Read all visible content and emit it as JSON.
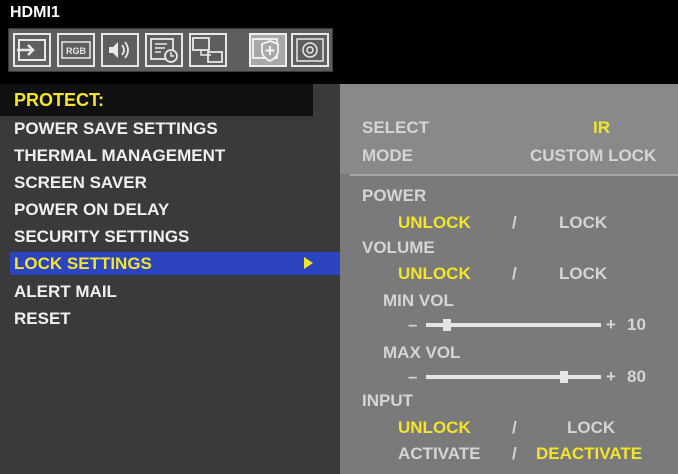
{
  "header": {
    "input_name": "HDMI1"
  },
  "icon_tabs": [
    {
      "name": "input-icon"
    },
    {
      "name": "rgb-icon",
      "label": "RGB"
    },
    {
      "name": "audio-icon"
    },
    {
      "name": "schedule-icon"
    },
    {
      "name": "multi-display-icon"
    },
    {
      "name": "protect-icon",
      "selected": true
    },
    {
      "name": "system-icon"
    }
  ],
  "menu": {
    "title": "PROTECT:",
    "items": [
      {
        "label": "POWER SAVE SETTINGS"
      },
      {
        "label": "THERMAL MANAGEMENT"
      },
      {
        "label": "SCREEN SAVER"
      },
      {
        "label": "POWER ON DELAY"
      },
      {
        "label": "SECURITY SETTINGS"
      },
      {
        "label": "LOCK SETTINGS",
        "selected": true
      },
      {
        "label": "ALERT MAIL"
      },
      {
        "label": "RESET"
      }
    ]
  },
  "lock_settings": {
    "select_label": "SELECT",
    "select_value": "IR",
    "mode_label": "MODE",
    "mode_value": "CUSTOM LOCK",
    "power": {
      "label": "POWER",
      "unlock": "UNLOCK",
      "sep": "/",
      "lock": "LOCK",
      "selected": "UNLOCK"
    },
    "volume": {
      "label": "VOLUME",
      "unlock": "UNLOCK",
      "sep": "/",
      "lock": "LOCK",
      "selected": "UNLOCK",
      "min_vol": {
        "label": "MIN VOL",
        "minus": "–",
        "plus": "+",
        "value": "10",
        "level": 10
      },
      "max_vol": {
        "label": "MAX VOL",
        "minus": "–",
        "plus": "+",
        "value": "80",
        "level": 80
      }
    },
    "input": {
      "label": "INPUT",
      "unlock": "UNLOCK",
      "sep": "/",
      "lock": "LOCK",
      "selected": "UNLOCK",
      "activate": "ACTIVATE",
      "sep2": "/",
      "deactivate": "DEACTIVATE",
      "state": "DEACTIVATE"
    }
  },
  "colors": {
    "highlight_text": "#f2e62a",
    "selection_bar": "#2d44c0",
    "inactive_text": "#d5d5d5"
  }
}
